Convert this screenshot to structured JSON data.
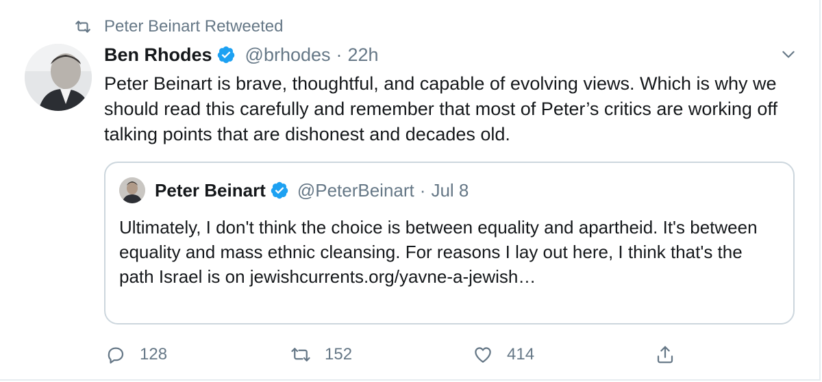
{
  "retweet_banner": {
    "icon": "retweet-icon",
    "text": "Peter Beinart Retweeted"
  },
  "tweet": {
    "author_name": "Ben Rhodes",
    "author_handle": "@brhodes",
    "separator": "·",
    "time": "22h",
    "verified_icon": "verified-badge-icon",
    "text": "Peter Beinart is brave, thoughtful, and capable of evolving views. Which is why we should read this carefully and remember that most of Peter’s critics are working off talking points that are dishonest and decades old."
  },
  "quoted_tweet": {
    "author_name": "Peter Beinart",
    "author_handle": "@PeterBeinart",
    "separator": "·",
    "time": "Jul 8",
    "text": "Ultimately, I don't think the choice is between equality and apartheid. It's between equality and mass ethnic cleansing. For reasons I lay out here, I think that's the path Israel is on jewishcurrents.org/yavne-a-jewish…"
  },
  "actions": {
    "reply_count": "128",
    "retweet_count": "152",
    "like_count": "414"
  },
  "colors": {
    "text": "#14171a",
    "secondary": "#657786",
    "verified": "#1da1f2",
    "border": "#ccd6dd"
  }
}
